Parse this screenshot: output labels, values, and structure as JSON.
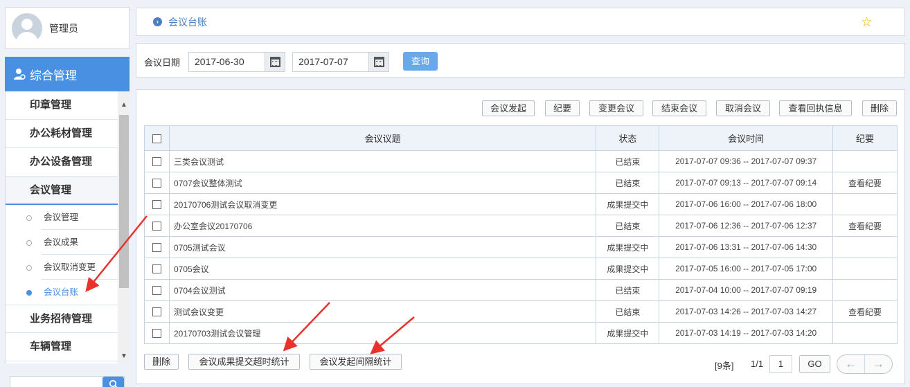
{
  "user": {
    "name": "管理员"
  },
  "nav": {
    "header": "综合管理",
    "items": [
      {
        "label": "印章管理"
      },
      {
        "label": "办公耗材管理"
      },
      {
        "label": "办公设备管理"
      },
      {
        "label": "会议管理"
      },
      {
        "label": "业务招待管理"
      },
      {
        "label": "车辆管理"
      }
    ],
    "sub_items": [
      {
        "label": "会议管理"
      },
      {
        "label": "会议成果"
      },
      {
        "label": "会议取消变更"
      },
      {
        "label": "会议台账"
      }
    ]
  },
  "breadcrumb": {
    "current": "会议台账"
  },
  "filter": {
    "label": "会议日期",
    "date_from": "2017-06-30",
    "date_to": "2017-07-07",
    "query_label": "查询"
  },
  "toolbar": {
    "start": "会议发起",
    "minutes": "纪要",
    "change": "变更会议",
    "end": "结束会议",
    "cancel": "取消会议",
    "receipt": "查看回执信息",
    "delete": "删除"
  },
  "table": {
    "columns": [
      "会议议题",
      "状态",
      "会议时间",
      "纪要"
    ],
    "rows": [
      {
        "title": "三类会议测试",
        "status": "已结束",
        "time": "2017-07-07 09:36 -- 2017-07-07 09:37",
        "minutes": ""
      },
      {
        "title": "0707会议整体测试",
        "status": "已结束",
        "time": "2017-07-07 09:13 -- 2017-07-07 09:14",
        "minutes": "查看纪要"
      },
      {
        "title": "20170706测试会议取消变更",
        "status": "成果提交中",
        "time": "2017-07-06 16:00 -- 2017-07-06 18:00",
        "minutes": ""
      },
      {
        "title": "办公室会议20170706",
        "status": "已结束",
        "time": "2017-07-06 12:36 -- 2017-07-06 12:37",
        "minutes": "查看纪要"
      },
      {
        "title": "0705测试会议",
        "status": "成果提交中",
        "time": "2017-07-06 13:31 -- 2017-07-06 14:30",
        "minutes": ""
      },
      {
        "title": "0705会议",
        "status": "成果提交中",
        "time": "2017-07-05 16:00 -- 2017-07-05 17:00",
        "minutes": ""
      },
      {
        "title": "0704会议测试",
        "status": "已结束",
        "time": "2017-07-04 10:00 -- 2017-07-07 09:19",
        "minutes": ""
      },
      {
        "title": "测试会议变更",
        "status": "已结束",
        "time": "2017-07-03 14:26 -- 2017-07-03 14:27",
        "minutes": "查看纪要"
      },
      {
        "title": "20170703测试会议管理",
        "status": "成果提交中",
        "time": "2017-07-03 14:19 -- 2017-07-03 14:20",
        "minutes": ""
      }
    ]
  },
  "footer": {
    "delete": "删除",
    "timeout_stats": "会议成果提交超时统计",
    "interval_stats": "会议发起间隔统计"
  },
  "pager": {
    "count": "[9条]",
    "pages": "1/1",
    "current_page": "1",
    "go": "GO",
    "prev": "←",
    "next": "→"
  },
  "colors": {
    "accent": "#4a90e2",
    "link": "#4a7fc0",
    "annotation": "#e8322c"
  }
}
